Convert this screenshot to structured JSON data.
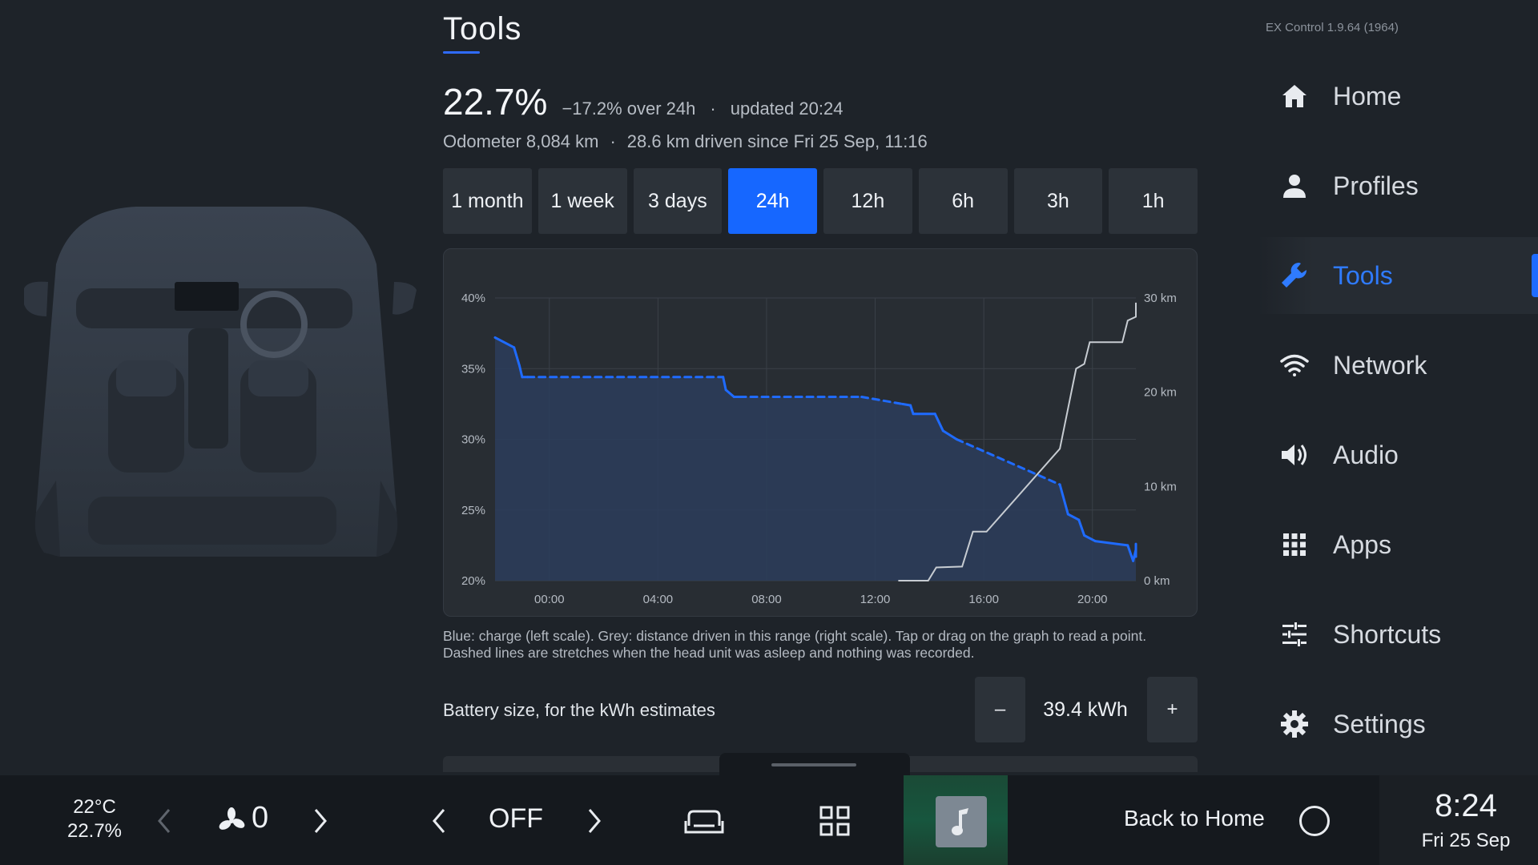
{
  "header": {
    "title": "Tools",
    "version": "EX Control 1.9.64 (1964)"
  },
  "summary": {
    "charge": "22.7%",
    "delta": "−17.2% over 24h",
    "separator": "·",
    "updated": "updated 20:24",
    "odometer": "Odometer 8,084 km",
    "driven": "28.6 km driven since Fri 25 Sep, 11:16"
  },
  "ranges": [
    {
      "label": "1 month",
      "active": false
    },
    {
      "label": "1 week",
      "active": false
    },
    {
      "label": "3 days",
      "active": false
    },
    {
      "label": "24h",
      "active": true
    },
    {
      "label": "12h",
      "active": false
    },
    {
      "label": "6h",
      "active": false
    },
    {
      "label": "3h",
      "active": false
    },
    {
      "label": "1h",
      "active": false
    }
  ],
  "chart_data": {
    "type": "line",
    "title": "",
    "x_tick_labels": [
      "00:00",
      "04:00",
      "08:00",
      "12:00",
      "16:00",
      "20:00"
    ],
    "x_ticks_hours": [
      2,
      6,
      10,
      14,
      18,
      22
    ],
    "xlim_hours": [
      0,
      23.6
    ],
    "y_left_label": "",
    "y_left_ticks": [
      "40%",
      "35%",
      "30%",
      "25%",
      "20%"
    ],
    "ylim_left": [
      20,
      40
    ],
    "y_right_ticks": [
      "30 km",
      "20 km",
      "10 km",
      "0 km"
    ],
    "ylim_right": [
      0,
      30
    ],
    "grid": true,
    "colors": {
      "charge": "#1f6bff",
      "distance": "#c7ccd2",
      "fill": "#2b3d5c"
    },
    "series": [
      {
        "axis": "left",
        "points": [
          {
            "x": 0.0,
            "y": 37.2,
            "dashed": false
          },
          {
            "x": 0.7,
            "y": 36.5,
            "dashed": false
          },
          {
            "x": 0.9,
            "y": 35.2,
            "dashed": false
          },
          {
            "x": 1.0,
            "y": 34.4,
            "dashed": false
          },
          {
            "x": 1.2,
            "y": 34.4,
            "dashed": true
          },
          {
            "x": 8.4,
            "y": 34.4,
            "dashed": false
          },
          {
            "x": 8.5,
            "y": 33.5,
            "dashed": false
          },
          {
            "x": 8.8,
            "y": 33.0,
            "dashed": false
          },
          {
            "x": 9.0,
            "y": 33.0,
            "dashed": true
          },
          {
            "x": 13.5,
            "y": 33.0,
            "dashed": true
          },
          {
            "x": 15.0,
            "y": 32.5,
            "dashed": false
          },
          {
            "x": 15.3,
            "y": 32.4,
            "dashed": false
          },
          {
            "x": 15.4,
            "y": 31.8,
            "dashed": false
          },
          {
            "x": 16.2,
            "y": 31.8,
            "dashed": false
          },
          {
            "x": 16.5,
            "y": 30.6,
            "dashed": false
          },
          {
            "x": 17.0,
            "y": 30.0,
            "dashed": true
          },
          {
            "x": 20.8,
            "y": 26.8,
            "dashed": false
          },
          {
            "x": 21.1,
            "y": 24.7,
            "dashed": false
          },
          {
            "x": 21.5,
            "y": 24.3,
            "dashed": false
          },
          {
            "x": 21.7,
            "y": 23.2,
            "dashed": false
          },
          {
            "x": 22.1,
            "y": 22.8,
            "dashed": false
          },
          {
            "x": 23.3,
            "y": 22.5,
            "dashed": false
          },
          {
            "x": 23.5,
            "y": 21.4,
            "dashed": false
          },
          {
            "x": 23.7,
            "y": 22.2,
            "dashed": false
          },
          {
            "x": 23.9,
            "y": 21.7,
            "dashed": false
          },
          {
            "x": 24.1,
            "y": 22.6,
            "dashed": false
          }
        ]
      },
      {
        "axis": "right",
        "points": [
          {
            "x": 14.85,
            "y": 0.0
          },
          {
            "x": 15.95,
            "y": 0.0
          },
          {
            "x": 16.25,
            "y": 1.4
          },
          {
            "x": 17.2,
            "y": 1.5
          },
          {
            "x": 17.6,
            "y": 5.2
          },
          {
            "x": 18.1,
            "y": 5.2
          },
          {
            "x": 20.8,
            "y": 14.0
          },
          {
            "x": 21.4,
            "y": 22.5
          },
          {
            "x": 21.7,
            "y": 23.0
          },
          {
            "x": 21.9,
            "y": 25.3
          },
          {
            "x": 23.1,
            "y": 25.3
          },
          {
            "x": 23.3,
            "y": 27.6
          },
          {
            "x": 23.6,
            "y": 28.0
          },
          {
            "x": 23.75,
            "y": 29.3
          },
          {
            "x": 24.0,
            "y": 29.5
          }
        ]
      }
    ]
  },
  "caption": "Blue: charge (left scale).  Grey: distance driven in this range (right scale). Tap or drag on the graph to read a point. Dashed lines are stretches when the head unit was asleep and nothing was recorded.",
  "battery": {
    "label": "Battery size, for the kWh estimates",
    "minus": "–",
    "value": "39.4 kWh",
    "plus": "+"
  },
  "nav": {
    "items": [
      {
        "label": "Home",
        "icon": "home-icon",
        "active": false
      },
      {
        "label": "Profiles",
        "icon": "person-icon",
        "active": false
      },
      {
        "label": "Tools",
        "icon": "wrench-icon",
        "active": true
      },
      {
        "label": "Network",
        "icon": "wifi-icon",
        "active": false
      },
      {
        "label": "Audio",
        "icon": "speaker-icon",
        "active": false
      },
      {
        "label": "Apps",
        "icon": "grid-icon",
        "active": false
      },
      {
        "label": "Shortcuts",
        "icon": "sliders-icon",
        "active": false
      },
      {
        "label": "Settings",
        "icon": "gear-icon",
        "active": false
      }
    ],
    "accent": "#2f7bff"
  },
  "bottom": {
    "temp": "22°C",
    "charge": "22.7%",
    "fan_level": "0",
    "mode": "OFF",
    "back_home": "Back to Home",
    "time": "8:24",
    "date": "Fri 25 Sep"
  }
}
